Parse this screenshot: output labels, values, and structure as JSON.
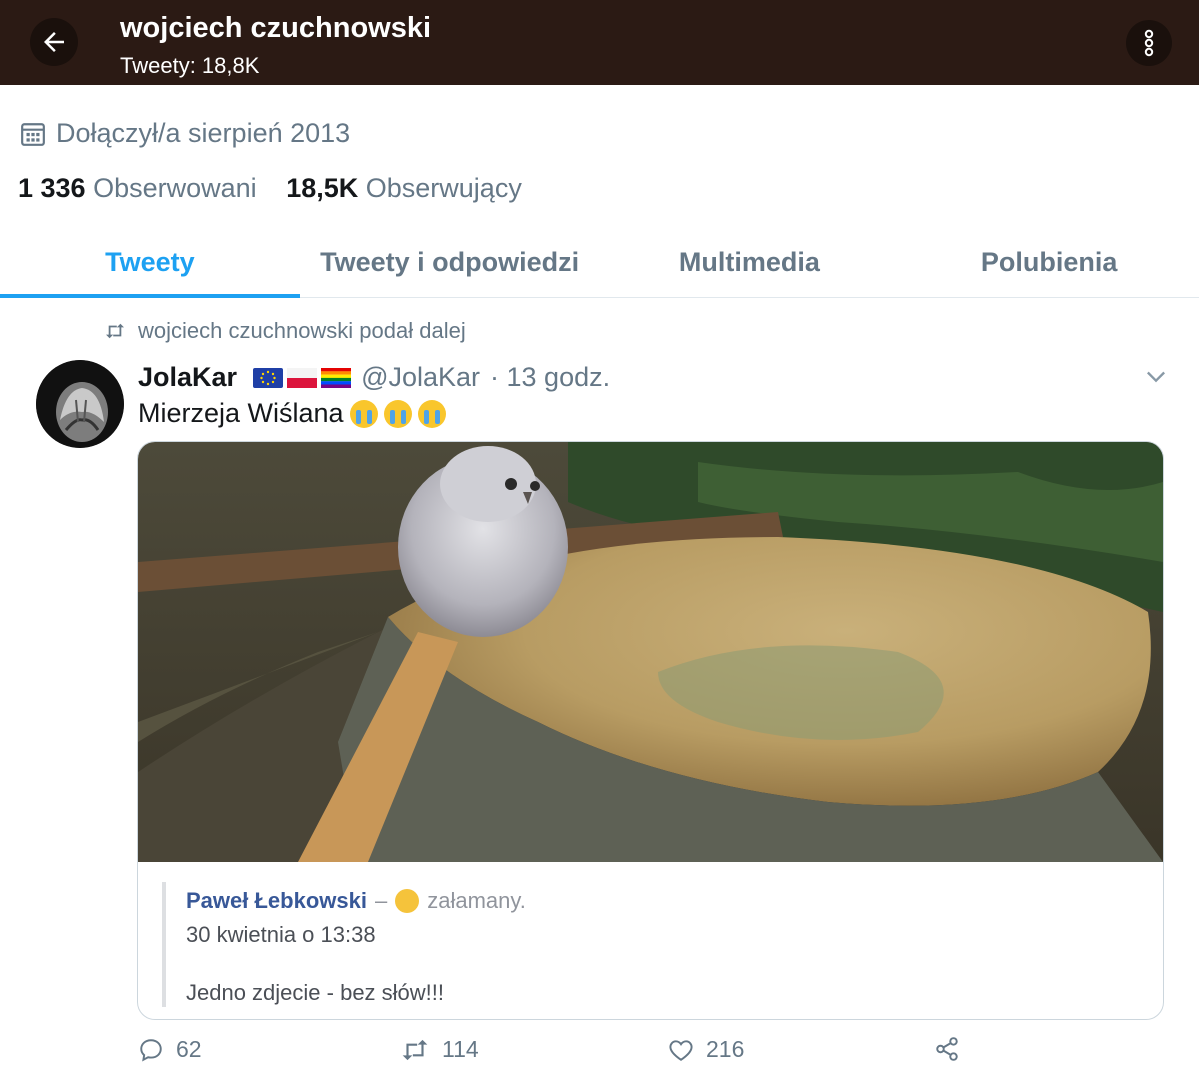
{
  "header": {
    "title": "wojciech czuchnowski",
    "subtitle": "Tweety: 18,8K"
  },
  "profile": {
    "joined": "Dołączył/a sierpień 2013",
    "following_count": "1 336",
    "following_label": "Obserwowani",
    "followers_count": "18,5K",
    "followers_label": "Obserwujący"
  },
  "tabs": [
    {
      "label": "Tweety",
      "active": true
    },
    {
      "label": "Tweety i odpowiedzi",
      "active": false
    },
    {
      "label": "Multimedia",
      "active": false
    },
    {
      "label": "Polubienia",
      "active": false
    }
  ],
  "tweet": {
    "retweeted_by": "wojciech czuchnowski podał dalej",
    "author_name": "JolaKar",
    "author_handle": "@JolaKar",
    "time": "· 13 godz.",
    "text": "Mierzeja Wiślana",
    "quote": {
      "author": "Paweł Łebkowski",
      "dash": "–",
      "feeling": "załamany.",
      "date": "30 kwietnia o 13:38",
      "text": "Jedno zdjecie - bez słów!!!"
    },
    "actions": {
      "replies": "62",
      "retweets": "114",
      "likes": "216"
    }
  },
  "colors": {
    "header_bg": "#2b1a14",
    "accent": "#1da1f2",
    "muted": "#657786"
  }
}
